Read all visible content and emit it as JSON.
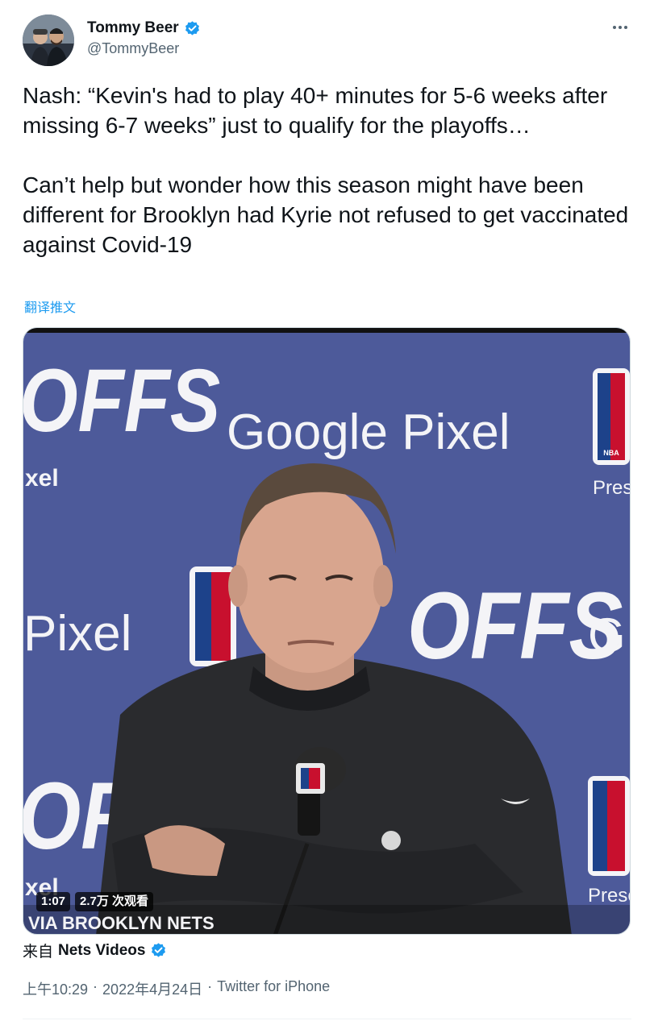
{
  "author": {
    "display_name": "Tommy Beer",
    "handle": "@TommyBeer",
    "verified": true
  },
  "tweet": {
    "paragraphs": [
      "Nash: “Kevin's had to play 40+ minutes for 5-6 weeks after missing 6-7 weeks” just to qualify for the playoffs…",
      "Can’t help but wonder how this season might have been different for Brooklyn had Kyrie not refused to get vaccinated against Covid-19"
    ],
    "translate_label": "翻译推文"
  },
  "media": {
    "duration": "1:07",
    "views": "2.7万 次观看",
    "backdrop_text": {
      "brand": "Google Pixel",
      "pixel": "Pixel",
      "offs": "OFFS",
      "xel": "xel",
      "nba": "NBA",
      "present": "Presen",
      "g": "G"
    },
    "caption": "VIA BROOKLYN NETS"
  },
  "source": {
    "prefix": "来自",
    "name": "Nets Videos",
    "verified": true
  },
  "meta": {
    "time": "上午10:29",
    "separator": "·",
    "date": "2022年4月24日",
    "client": "Twitter for iPhone"
  },
  "colors": {
    "accent": "#1d9bf0",
    "text_primary": "#0f1419",
    "text_secondary": "#536471",
    "backdrop_blue": "#4d5a9a"
  },
  "icons": {
    "verified": "verified-badge-icon",
    "more": "more-horizontal-icon"
  }
}
